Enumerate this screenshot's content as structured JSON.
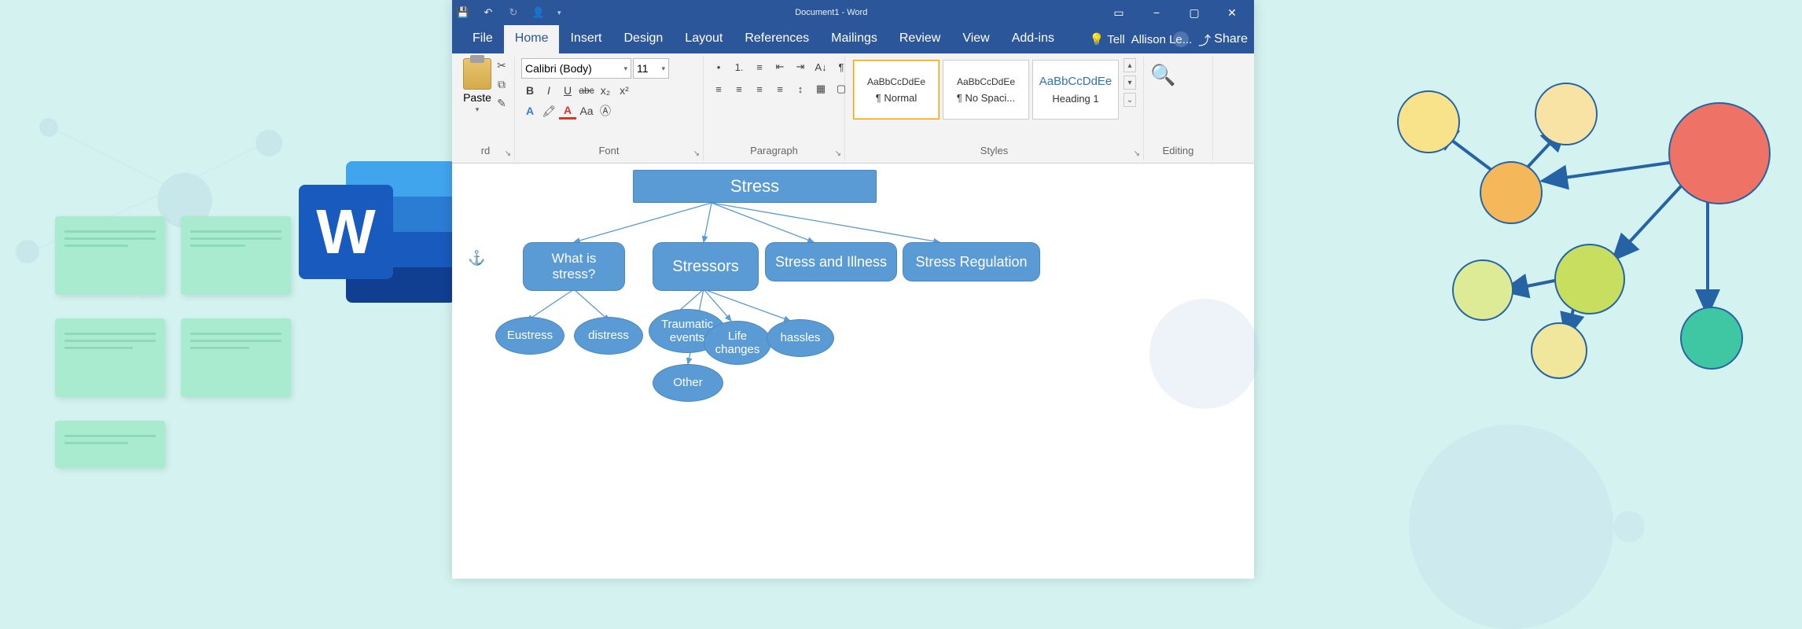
{
  "window": {
    "title": "Document1 - Word"
  },
  "qat": {
    "save": "💾",
    "undo": "↶",
    "redo": "↻",
    "user": "👤"
  },
  "win": {
    "opts": "▭",
    "min": "−",
    "max": "▢",
    "close": "✕"
  },
  "tabs": {
    "file": "File",
    "home": "Home",
    "insert": "Insert",
    "design": "Design",
    "layout": "Layout",
    "references": "References",
    "mailings": "Mailings",
    "review": "Review",
    "view": "View",
    "addins": "Add-ins",
    "tell": "Tell",
    "tell_icon": "💡",
    "user": "Allison Le...",
    "share": "Share",
    "share_icon": "⤴"
  },
  "ribbon": {
    "paste": "Paste",
    "clipboard": "rd",
    "cut": "✂",
    "copy": "⧉",
    "brush": "✎",
    "font_name": "Calibri (Body)",
    "font_size": "11",
    "bold": "B",
    "italic": "I",
    "underline": "U",
    "strike": "abc",
    "sub": "x₂",
    "sup": "x²",
    "fontfx": "A",
    "hilite": "🖍",
    "fontcolor": "A",
    "case": "Aa",
    "clear": "Ⓐ",
    "font_label": "Font",
    "bullets": "•",
    "numbers": "1.",
    "multi": "≡",
    "indL": "⇤",
    "indR": "⇥",
    "sort": "A↓",
    "pil": "¶",
    "alignL": "≡",
    "alignC": "≡",
    "alignR": "≡",
    "alignJ": "≡",
    "lineSp": "↕",
    "shade": "▦",
    "border": "▢",
    "para_label": "Paragraph",
    "style_preview": "AaBbCcDdEe",
    "style_normal": "¶ Normal",
    "style_nospaci": "¶ No Spaci...",
    "style_h1": "Heading 1",
    "styles_label": "Styles",
    "find": "🔍",
    "editing_label": "Editing",
    "dd": "▾",
    "dlg": "↘"
  },
  "diagram": {
    "root": "Stress",
    "lvl2": {
      "what": "What is stress?",
      "stressors": "Stressors",
      "illness": "Stress and Illness",
      "reg": "Stress Regulation"
    },
    "lvl3": {
      "eustress": "Eustress",
      "distress": "distress",
      "traumatic": "Traumatic events",
      "life": "Life changes",
      "hassles": "hassles",
      "other": "Other"
    }
  },
  "anchor": "⚓"
}
